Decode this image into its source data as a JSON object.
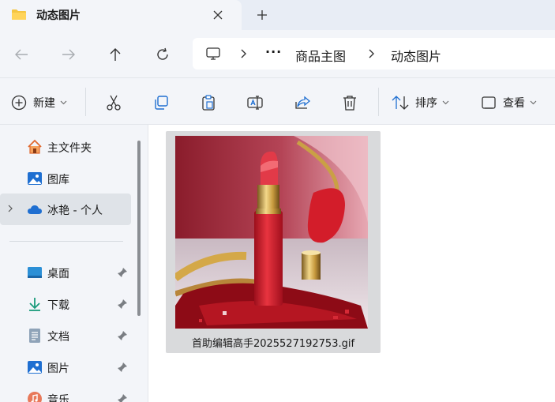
{
  "tab": {
    "title": "动态图片",
    "close_icon": "close-icon",
    "new_tab_icon": "plus-icon"
  },
  "nav": {
    "back_icon": "arrow-left-icon",
    "forward_icon": "arrow-right-icon",
    "up_icon": "arrow-up-icon",
    "refresh_icon": "refresh-icon"
  },
  "address": {
    "root_icon": "monitor-icon",
    "overflow": "···",
    "crumbs": [
      "商品主图",
      "动态图片"
    ]
  },
  "toolbar": {
    "new_label": "新建",
    "sort_label": "排序",
    "view_label": "查看",
    "icons": [
      "cut-icon",
      "copy-icon",
      "paste-icon",
      "rename-icon",
      "share-icon",
      "delete-icon"
    ]
  },
  "sidebar": {
    "items": [
      {
        "label": "主文件夹",
        "icon": "home-icon"
      },
      {
        "label": "图库",
        "icon": "gallery-icon"
      },
      {
        "label": "冰艳 - 个人",
        "icon": "cloud-icon"
      },
      {
        "label": "桌面",
        "icon": "desktop-icon",
        "pinned": true
      },
      {
        "label": "下载",
        "icon": "download-icon",
        "pinned": true
      },
      {
        "label": "文档",
        "icon": "document-icon",
        "pinned": true
      },
      {
        "label": "图片",
        "icon": "pictures-icon",
        "pinned": true
      },
      {
        "label": "音乐",
        "icon": "music-icon",
        "pinned": true
      }
    ]
  },
  "files": [
    {
      "name": "首助编辑高手2025527192753.gif",
      "selected": true
    }
  ],
  "colors": {
    "accent": "#0067c0",
    "folder": "#f4c542",
    "onedrive": "#1f6fd1",
    "lipstick": "#d0202e"
  }
}
